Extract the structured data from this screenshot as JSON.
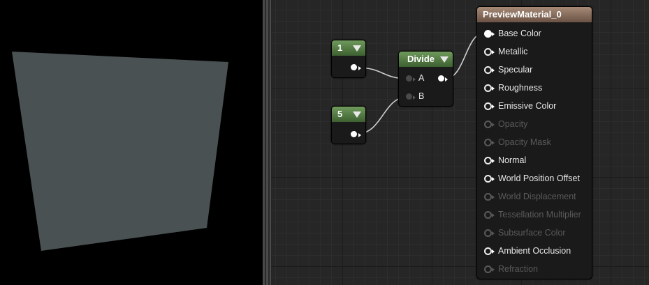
{
  "graph": {
    "const_one": {
      "value": "1"
    },
    "const_five": {
      "value": "5"
    },
    "divide": {
      "title": "Divide",
      "input_a": "A",
      "input_b": "B"
    },
    "material": {
      "title": "PreviewMaterial_0",
      "inputs": [
        {
          "label": "Base Color",
          "state": "connected"
        },
        {
          "label": "Metallic",
          "state": "enabled"
        },
        {
          "label": "Specular",
          "state": "enabled"
        },
        {
          "label": "Roughness",
          "state": "enabled"
        },
        {
          "label": "Emissive Color",
          "state": "enabled"
        },
        {
          "label": "Opacity",
          "state": "disabled"
        },
        {
          "label": "Opacity Mask",
          "state": "disabled"
        },
        {
          "label": "Normal",
          "state": "enabled"
        },
        {
          "label": "World Position Offset",
          "state": "enabled"
        },
        {
          "label": "World Displacement",
          "state": "disabled"
        },
        {
          "label": "Tessellation Multiplier",
          "state": "disabled"
        },
        {
          "label": "Subsurface Color",
          "state": "disabled"
        },
        {
          "label": "Ambient Occlusion",
          "state": "enabled"
        },
        {
          "label": "Refraction",
          "state": "disabled"
        }
      ]
    }
  },
  "preview": {
    "surface_color": "#4a5152"
  }
}
